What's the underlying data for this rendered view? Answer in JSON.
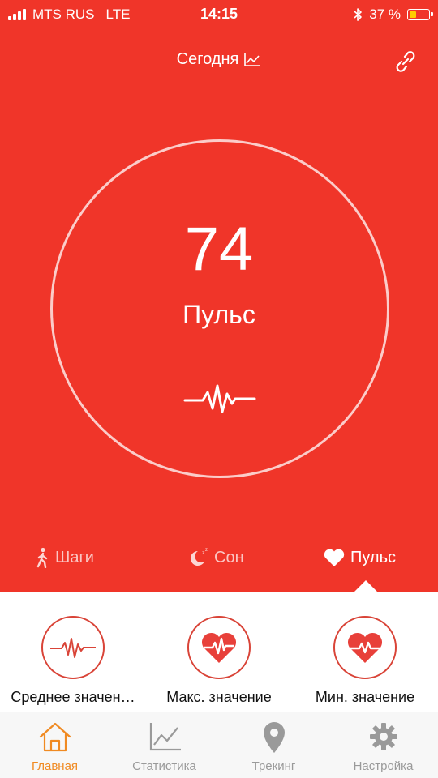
{
  "status_bar": {
    "carrier": "MTS RUS",
    "network": "LTE",
    "time": "14:15",
    "battery": "37 %",
    "battery_level": 0.37,
    "battery_color": "#ffcc00"
  },
  "header": {
    "title": "Сегодня"
  },
  "summary": {
    "value": "74",
    "label": "Пульс"
  },
  "tabs": [
    {
      "label": "Шаги",
      "icon": "walk-icon"
    },
    {
      "label": "Сон",
      "icon": "moon-icon"
    },
    {
      "label": "Пульс",
      "icon": "heart-icon",
      "active": true
    }
  ],
  "stats": [
    {
      "label": "Среднее значен…",
      "icon": "pulse-wave-icon"
    },
    {
      "label": "Макс. значение",
      "icon": "heart-pulse-icon"
    },
    {
      "label": "Мин. значение",
      "icon": "heart-pulse-icon"
    }
  ],
  "tab_bar": [
    {
      "label": "Главная",
      "icon": "home-icon",
      "active": true
    },
    {
      "label": "Статистика",
      "icon": "chart-icon"
    },
    {
      "label": "Трекинг",
      "icon": "location-pin-icon"
    },
    {
      "label": "Настройка",
      "icon": "gear-icon"
    }
  ],
  "colors": {
    "accent": "#f03529",
    "active_tab": "#f08a22",
    "inactive_tab": "#9a9a9a"
  }
}
